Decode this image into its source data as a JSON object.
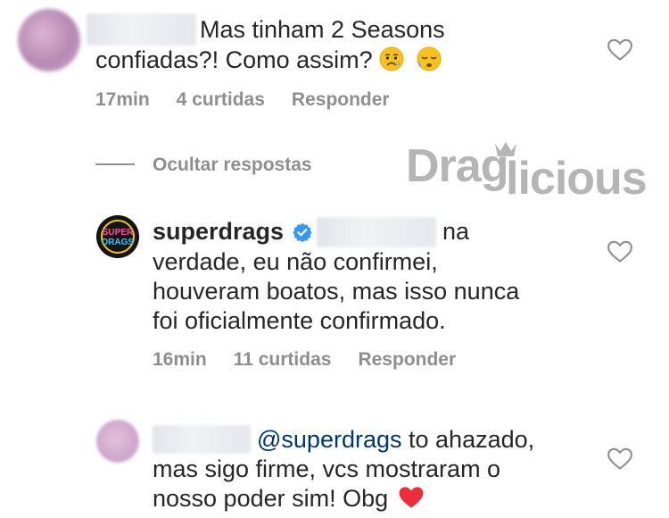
{
  "comments": [
    {
      "text_line1": "Mas tinham 2 Seasons",
      "text_line2": "confiadas?! Como assim?",
      "emoji": [
        "sad-relieved-face-icon",
        "sleepy-face-icon"
      ],
      "time": "17min",
      "likes": "4 curtidas",
      "reply": "Responder"
    },
    {
      "username": "superdrags",
      "text_line1": "na",
      "text_line2": "verdade, eu não confirmei,",
      "text_line3": "houveram boatos, mas isso nunca",
      "text_line4": "foi oficialmente confirmado.",
      "time": "16min",
      "likes": "11 curtidas",
      "reply": "Responder"
    },
    {
      "mention": "@superdrags",
      "text_line1": "to ahazado,",
      "text_line2": "mas sigo firme, vcs mostraram o",
      "text_line3": "nosso poder sim! Obg",
      "emoji": [
        "red-heart-icon"
      ]
    }
  ],
  "hide_replies": "Ocultar respostas",
  "watermark": "Draglicious",
  "avatar_text": [
    "SUPER",
    "DRAGS"
  ],
  "colors": {
    "text": "#262626",
    "meta": "#8e8e8e",
    "mention": "#00376b",
    "verified": "#3897f0",
    "heart": "#ed2d3c",
    "watermark": "#b5b5b5"
  }
}
